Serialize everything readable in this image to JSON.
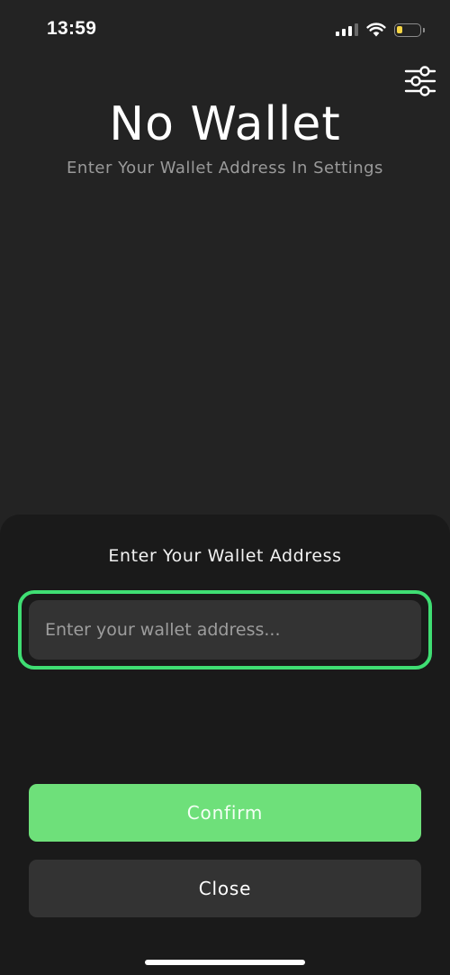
{
  "status_bar": {
    "time": "13:59"
  },
  "header": {
    "title": "No Wallet",
    "subtitle": "Enter Your Wallet Address In Settings"
  },
  "settings": {
    "icon": "sliders-icon"
  },
  "sheet": {
    "title": "Enter Your Wallet Address",
    "input": {
      "value": "",
      "placeholder": "Enter your wallet address..."
    },
    "confirm_label": "Confirm",
    "close_label": "Close"
  },
  "colors": {
    "background": "#232323",
    "sheet_background": "#1a1a1a",
    "accent_green": "#3fde73",
    "confirm_button": "#6ee07a",
    "close_button": "#333333",
    "input_background": "#333333",
    "battery": "#f6d544"
  }
}
